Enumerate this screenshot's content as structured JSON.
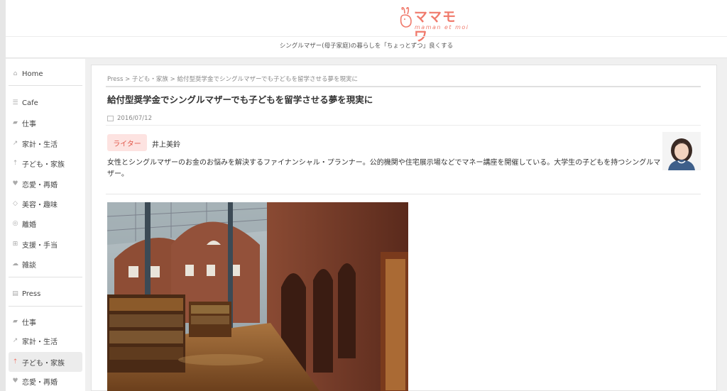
{
  "header": {
    "logo_text": "ママモワ",
    "logo_sub": "maman et moi",
    "tagline": "シングルマザー(母子家庭)の暮らしを「ちょっとずつ」良くする"
  },
  "sidebar": {
    "items": [
      {
        "label": "Home",
        "icon": "home-icon"
      },
      {
        "label": "Cafe",
        "icon": "cafe-icon"
      },
      {
        "label": "仕事",
        "icon": "briefcase-icon"
      },
      {
        "label": "家計・生活",
        "icon": "chart-icon"
      },
      {
        "label": "子ども・家族",
        "icon": "child-icon"
      },
      {
        "label": "恋愛・再婚",
        "icon": "heart-icon"
      },
      {
        "label": "美容・趣味",
        "icon": "diamond-icon"
      },
      {
        "label": "離婚",
        "icon": "ring-icon"
      },
      {
        "label": "支援・手当",
        "icon": "plus-icon"
      },
      {
        "label": "雑談",
        "icon": "chat-icon"
      },
      {
        "label": "Press",
        "icon": "press-icon"
      },
      {
        "label": "仕事",
        "icon": "briefcase-icon"
      },
      {
        "label": "家計・生活",
        "icon": "chart-icon"
      },
      {
        "label": "子ども・家族",
        "icon": "child-icon"
      },
      {
        "label": "恋愛・再婚",
        "icon": "heart-icon"
      }
    ]
  },
  "article": {
    "breadcrumb": [
      "Press",
      "子ども・家族",
      "給付型奨学金でシングルマザーでも子どもを留学させる夢を現実に"
    ],
    "title": "給付型奨学金でシングルマザーでも子どもを留学させる夢を現実に",
    "date": "2016/07/12",
    "writer_label": "ライター",
    "writer_name": "井上美鈴",
    "writer_desc": "女性とシングルマザーのお金のお悩みを解決するファイナンシャル・プランナー。公的機関や住宅展示場などでマネー講座を開催している。大学生の子どもを持つシングルマザー。"
  },
  "colors": {
    "accent": "#f07a6c",
    "badge_bg": "#fde3e1"
  }
}
